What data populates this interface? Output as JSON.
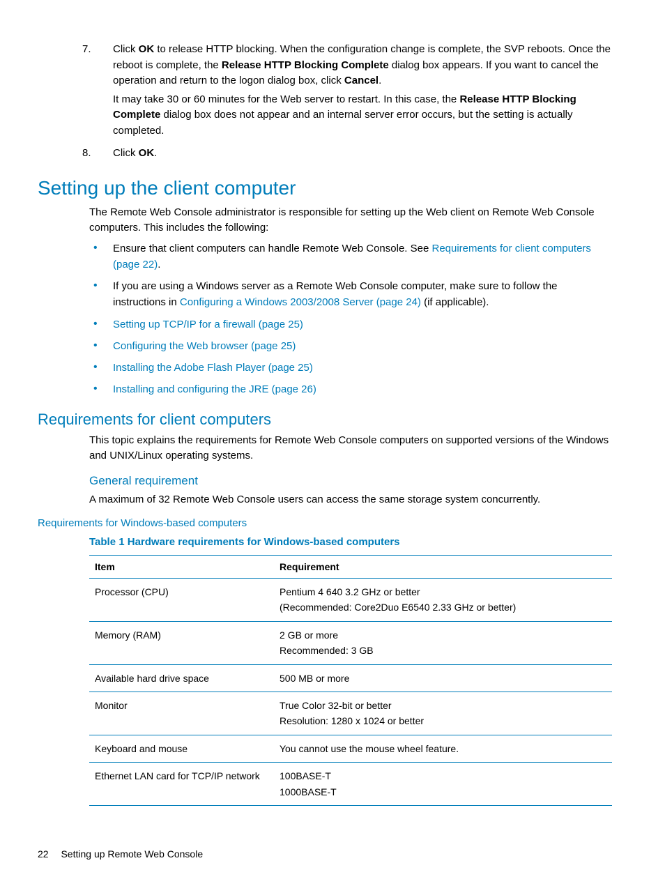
{
  "steps": {
    "s7": {
      "num": "7.",
      "p1_a": "Click ",
      "p1_b_bold": "OK",
      "p1_c": " to release HTTP blocking. When the configuration change is complete, the SVP reboots. Once the reboot is complete, the ",
      "p1_d_bold": "Release HTTP Blocking Complete",
      "p1_e": " dialog box appears. If you want to cancel the operation and return to the logon dialog box, click ",
      "p1_f_bold": "Cancel",
      "p1_g": ".",
      "p2_a": "It may take 30 or 60 minutes for the Web server to restart. In this case, the ",
      "p2_b_bold": "Release HTTP Blocking Complete",
      "p2_c": " dialog box does not appear and an internal server error occurs, but the setting is actually completed."
    },
    "s8": {
      "num": "8.",
      "a": "Click ",
      "b_bold": "OK",
      "c": "."
    }
  },
  "h1": "Setting up the client computer",
  "intro": "The Remote Web Console administrator is responsible for setting up the Web client on Remote Web Console computers. This includes the following:",
  "bullets": {
    "b1_a": "Ensure that client computers can handle Remote Web Console. See ",
    "b1_link": "Requirements for client computers (page 22)",
    "b1_c": ".",
    "b2_a": "If you are using a Windows server as a Remote Web Console computer, make sure to follow the instructions in ",
    "b2_link": "Configuring a Windows 2003/2008 Server (page 24)",
    "b2_c": " (if applicable).",
    "b3_link": "Setting up TCP/IP for a firewall (page 25)",
    "b4_link": "Configuring the Web browser (page 25)",
    "b5_link": "Installing the Adobe Flash Player (page 25)",
    "b6_link": "Installing and configuring the JRE (page 26)"
  },
  "h2_req": "Requirements for client computers",
  "req_intro": "This topic explains the requirements for Remote Web Console computers on supported versions of the Windows and UNIX/Linux operating systems.",
  "h3_general": "General requirement",
  "general_text": "A maximum of 32 Remote Web Console users can access the same storage system concurrently.",
  "h4_win": "Requirements for Windows-based computers",
  "table_caption": "Table 1 Hardware requirements for Windows-based computers",
  "table": {
    "header": {
      "c1": "Item",
      "c2": "Requirement"
    },
    "rows": [
      {
        "item": "Processor (CPU)",
        "req_l1": "Pentium 4 640 3.2 GHz or better",
        "req_l2": "(Recommended: Core2Duo E6540 2.33 GHz or better)"
      },
      {
        "item": "Memory (RAM)",
        "req_l1": "2 GB or more",
        "req_l2": "Recommended: 3 GB"
      },
      {
        "item": "Available hard drive space",
        "req_l1": "500 MB or more",
        "req_l2": ""
      },
      {
        "item": "Monitor",
        "req_l1": "True Color 32-bit or better",
        "req_l2": "Resolution: 1280 x 1024 or better"
      },
      {
        "item": "Keyboard and mouse",
        "req_l1": "You cannot use the mouse wheel feature.",
        "req_l2": ""
      },
      {
        "item": "Ethernet LAN card for TCP/IP network",
        "req_l1": "100BASE-T",
        "req_l2": "1000BASE-T"
      }
    ]
  },
  "footer": {
    "page": "22",
    "section": "Setting up Remote Web Console"
  }
}
